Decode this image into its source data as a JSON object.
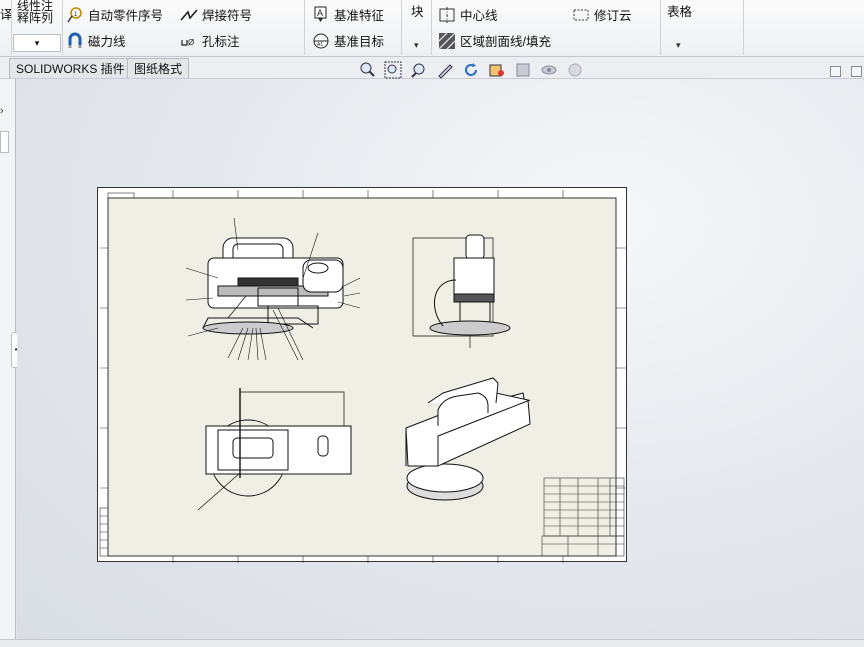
{
  "ribbon": {
    "partial_left_top": "译",
    "linear_note_line1": "线性注",
    "linear_note_line2": "释阵列",
    "auto_balloon": "自动零件序号",
    "magnet_line": "磁力线",
    "weld_symbol": "焊接符号",
    "hole_callout": "孔标注",
    "datum_feature": "基准特征",
    "datum_target": "基准目标",
    "block": "块",
    "center_line": "中心线",
    "area_hatch": "区域剖面线/填充",
    "revision_cloud": "修订云",
    "table": "表格"
  },
  "tabs": [
    {
      "label": "SOLIDWORKS 插件"
    },
    {
      "label": "图纸格式"
    }
  ],
  "view_tools": [
    "zoom-to-fit-icon",
    "zoom-area-icon",
    "previous-view-icon",
    "pan-icon",
    "rotate-icon",
    "display-style-icon",
    "section-view-icon",
    "hide-show-icon",
    "appearance-icon"
  ]
}
